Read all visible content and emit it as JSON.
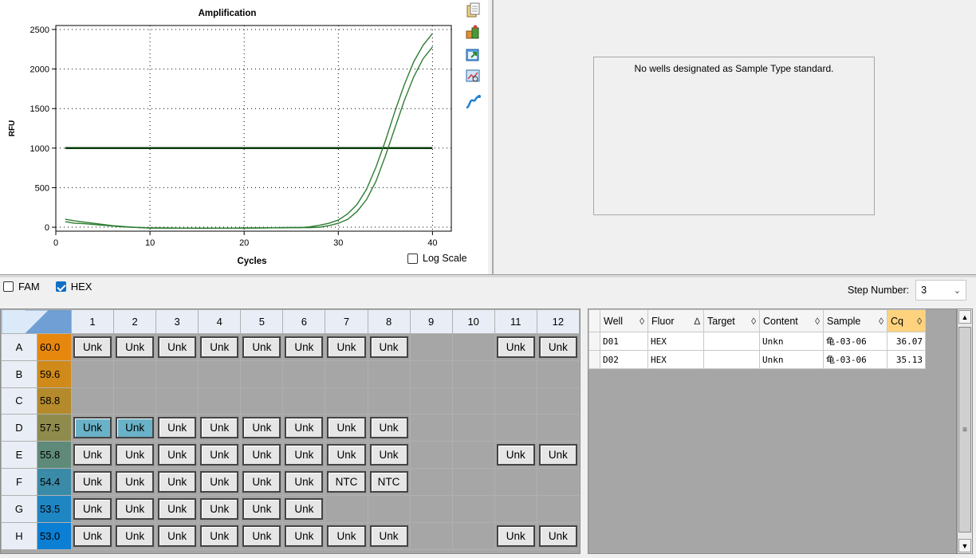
{
  "chart_data": {
    "type": "line",
    "title": "Amplification",
    "xlabel": "Cycles",
    "ylabel": "RFU",
    "xlim": [
      0,
      42
    ],
    "ylim": [
      -50,
      2550
    ],
    "xticks": [
      0,
      10,
      20,
      30,
      40
    ],
    "yticks": [
      0,
      500,
      1000,
      1500,
      2000,
      2500
    ],
    "grid": true,
    "threshold": 1000,
    "series": [
      {
        "x": [
          1,
          2,
          3,
          4,
          5,
          6,
          7,
          8,
          9,
          10,
          11,
          12,
          13,
          14,
          15,
          16,
          17,
          18,
          19,
          20,
          21,
          22,
          23,
          24,
          25,
          26,
          27,
          28,
          29,
          30,
          31,
          32,
          33,
          34,
          35,
          36,
          37,
          38,
          39,
          40
        ],
        "y": [
          70,
          50,
          45,
          35,
          25,
          15,
          5,
          0,
          -5,
          -10,
          -10,
          -12,
          -12,
          -12,
          -14,
          -14,
          -12,
          -12,
          -12,
          -10,
          -10,
          -8,
          -8,
          -5,
          -5,
          -5,
          5,
          25,
          50,
          90,
          170,
          290,
          480,
          760,
          1090,
          1460,
          1800,
          2090,
          2300,
          2450
        ]
      },
      {
        "x": [
          1,
          2,
          3,
          4,
          5,
          6,
          7,
          8,
          9,
          10,
          11,
          12,
          13,
          14,
          15,
          16,
          17,
          18,
          19,
          20,
          21,
          22,
          23,
          24,
          25,
          26,
          27,
          28,
          29,
          30,
          31,
          32,
          33,
          34,
          35,
          36,
          37,
          38,
          39,
          40
        ],
        "y": [
          100,
          80,
          65,
          50,
          35,
          20,
          10,
          0,
          -5,
          -10,
          -10,
          -10,
          -12,
          -12,
          -12,
          -12,
          -12,
          -12,
          -12,
          -10,
          -10,
          -10,
          -8,
          -8,
          -5,
          -5,
          -5,
          0,
          20,
          50,
          100,
          200,
          350,
          580,
          900,
          1250,
          1600,
          1900,
          2130,
          2280
        ]
      }
    ]
  },
  "log_scale": {
    "label": "Log Scale",
    "checked": false
  },
  "toolbar_icons": [
    "copy-icon",
    "export-icon",
    "open-window-icon",
    "chart-zoom-icon",
    "chart-tools-icon"
  ],
  "standard_curve_message": "No wells designated as Sample Type standard.",
  "fluors": [
    {
      "label": "FAM",
      "checked": false
    },
    {
      "label": "HEX",
      "checked": true
    }
  ],
  "step_number": {
    "label": "Step Number:",
    "value": "3"
  },
  "plate": {
    "columns": [
      "1",
      "2",
      "3",
      "4",
      "5",
      "6",
      "7",
      "8",
      "9",
      "10",
      "11",
      "12"
    ],
    "rows": [
      {
        "label": "A",
        "temp": "60.0",
        "color": "#e8870e",
        "wells": [
          "Unk",
          "Unk",
          "Unk",
          "Unk",
          "Unk",
          "Unk",
          "Unk",
          "Unk",
          "",
          "",
          "Unk",
          "Unk"
        ]
      },
      {
        "label": "B",
        "temp": "59.6",
        "color": "#d08a1a",
        "wells": [
          "",
          "",
          "",
          "",
          "",
          "",
          "",
          "",
          "",
          "",
          "",
          ""
        ]
      },
      {
        "label": "C",
        "temp": "58.8",
        "color": "#b58a2a",
        "wells": [
          "",
          "",
          "",
          "",
          "",
          "",
          "",
          "",
          "",
          "",
          "",
          ""
        ]
      },
      {
        "label": "D",
        "temp": "57.5",
        "color": "#8f8b4c",
        "wells": [
          "Unk",
          "Unk",
          "Unk",
          "Unk",
          "Unk",
          "Unk",
          "Unk",
          "Unk",
          "",
          "",
          "",
          ""
        ]
      },
      {
        "label": "E",
        "temp": "55.8",
        "color": "#5f8a7a",
        "wells": [
          "Unk",
          "Unk",
          "Unk",
          "Unk",
          "Unk",
          "Unk",
          "Unk",
          "Unk",
          "",
          "",
          "Unk",
          "Unk"
        ]
      },
      {
        "label": "F",
        "temp": "54.4",
        "color": "#3a8ba8",
        "wells": [
          "Unk",
          "Unk",
          "Unk",
          "Unk",
          "Unk",
          "Unk",
          "NTC",
          "NTC",
          "",
          "",
          "",
          ""
        ]
      },
      {
        "label": "G",
        "temp": "53.5",
        "color": "#1f86c4",
        "wells": [
          "Unk",
          "Unk",
          "Unk",
          "Unk",
          "Unk",
          "Unk",
          "",
          "",
          "",
          "",
          "",
          ""
        ]
      },
      {
        "label": "H",
        "temp": "53.0",
        "color": "#0a7fd4",
        "wells": [
          "Unk",
          "Unk",
          "Unk",
          "Unk",
          "Unk",
          "Unk",
          "Unk",
          "Unk",
          "",
          "",
          "Unk",
          "Unk"
        ]
      }
    ],
    "selected_wells": [
      "D1",
      "D2"
    ]
  },
  "well_table": {
    "columns": [
      {
        "label": "Well",
        "sort": "◊"
      },
      {
        "label": "Fluor",
        "sort": "∆"
      },
      {
        "label": "Target",
        "sort": "◊"
      },
      {
        "label": "Content",
        "sort": "◊"
      },
      {
        "label": "Sample",
        "sort": "◊"
      },
      {
        "label": "Cq",
        "sort": "◊"
      }
    ],
    "rows": [
      [
        "D01",
        "HEX",
        "",
        "Unkn",
        "龟-03-06",
        "36.07"
      ],
      [
        "D02",
        "HEX",
        "",
        "Unkn",
        "龟-03-06",
        "35.13"
      ]
    ]
  }
}
